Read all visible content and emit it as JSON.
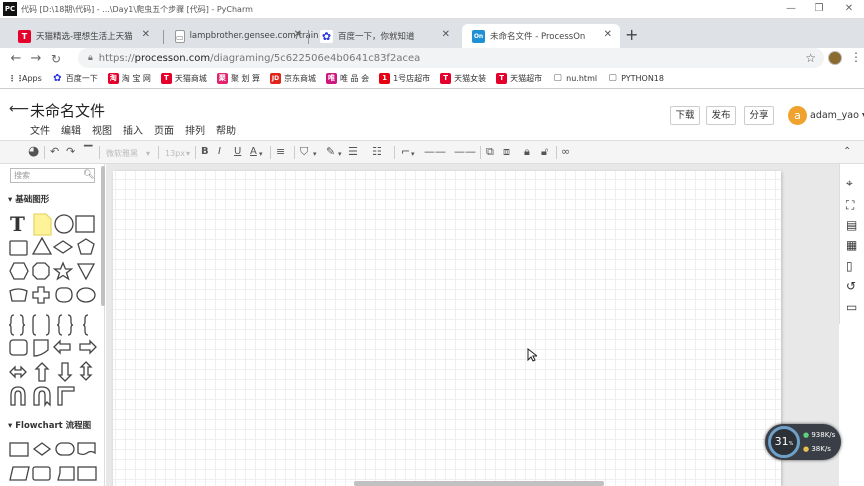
{
  "window": {
    "title": "代码 [D:\\18期\\代码] - ...\\Day1\\爬虫五个步骤 [代码] - PyCharm",
    "controls": [
      "—",
      "❐",
      "✕"
    ]
  },
  "tabs": [
    {
      "label": "天猫精选-理想生活上天猫",
      "favicon": "T",
      "color": "#e4002b"
    },
    {
      "label": "lampbrother.gensee.com/train",
      "favicon": "▭",
      "color": "#777"
    },
    {
      "label": "百度一下，你就知道",
      "favicon": "✿",
      "color": "#2932e1"
    },
    {
      "label": "未命名文件 - ProcessOn",
      "favicon": "On",
      "color": "#1e90d6"
    }
  ],
  "newtab_label": "+",
  "address": {
    "scheme": "https://",
    "host": "processon.com",
    "path": "/diagraming/5c622506e4b0641c83f2acea"
  },
  "bookmarks": [
    {
      "label": "Apps",
      "icon": "⋮⋮",
      "color": "#555"
    },
    {
      "label": "百度一下",
      "icon": "✿",
      "color": "#2932e1"
    },
    {
      "label": "淘 宝 网",
      "icon": "淘",
      "color": "#ff5000"
    },
    {
      "label": "天猫商城",
      "icon": "T",
      "color": "#e4002b"
    },
    {
      "label": "聚 划 算",
      "icon": "聚",
      "color": "#e1236d"
    },
    {
      "label": "京东商城",
      "icon": "JD",
      "color": "#e1251b"
    },
    {
      "label": "唯 品 会",
      "icon": "唯",
      "color": "#d1157e"
    },
    {
      "label": "1号店超市",
      "icon": "1",
      "color": "#e60012"
    },
    {
      "label": "天猫女装",
      "icon": "T",
      "color": "#e4002b"
    },
    {
      "label": "天猫超市",
      "icon": "T",
      "color": "#e4002b"
    },
    {
      "label": "nu.html",
      "icon": "▢",
      "color": "#777"
    },
    {
      "label": "PYTHON18",
      "icon": "▢",
      "color": "#777"
    }
  ],
  "app": {
    "back_icon": "⟵",
    "doc_title": "未命名文件",
    "menu": [
      "文件",
      "编辑",
      "视图",
      "插入",
      "页面",
      "排列",
      "帮助"
    ],
    "download": "下载",
    "publish": "发布",
    "share": "分享",
    "avatar_letter": "a",
    "username": "adam_yao ▾"
  },
  "toolbar": {
    "font": "微软雅黑",
    "font_size": "13px",
    "bold": "B",
    "italic": "I",
    "underline": "U",
    "fontcolor": "A"
  },
  "sidebar": {
    "search_placeholder": "搜索",
    "cat_basic": "▾ 基础图形",
    "cat_flow": "▾ Flowchart 流程图"
  },
  "netwidget": {
    "percent": "31",
    "unit": "%",
    "up": "938K/s",
    "down": "38K/s"
  }
}
